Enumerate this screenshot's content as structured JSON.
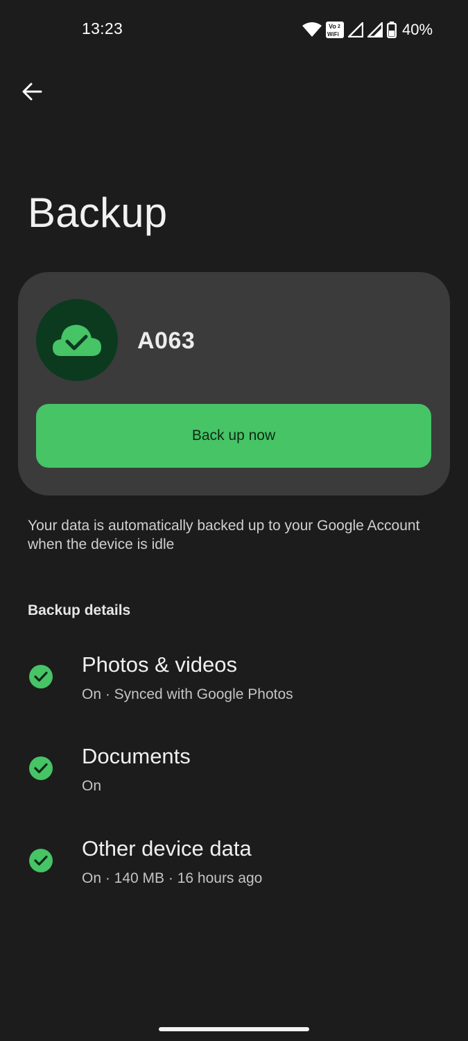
{
  "status_bar": {
    "time": "13:23",
    "vowifi_top": "Vo",
    "vowifi_num": "2",
    "vowifi_bottom": "WiFi",
    "battery_percent": "40%",
    "icons": [
      "wifi-icon",
      "vowifi-icon",
      "signal-icon",
      "signal-icon",
      "battery-icon"
    ]
  },
  "header": {
    "back_icon": "arrow-left-icon",
    "title": "Backup"
  },
  "card": {
    "icon": "cloud-check-icon",
    "device_name": "A063",
    "button_label": "Back up now"
  },
  "description": "Your data is automatically backed up to your Google Account when the device is idle",
  "details": {
    "section_title": "Backup details",
    "items": [
      {
        "title": "Photos & videos",
        "subtitle": "On · Synced with Google Photos"
      },
      {
        "title": "Documents",
        "subtitle": "On"
      },
      {
        "title": "Other device data",
        "subtitle": "On · 140 MB · 16 hours ago"
      }
    ]
  },
  "colors": {
    "background": "#1c1c1c",
    "card": "#3b3b3b",
    "accent_green": "#46c466",
    "avatar_bg": "#0b3a1f"
  }
}
